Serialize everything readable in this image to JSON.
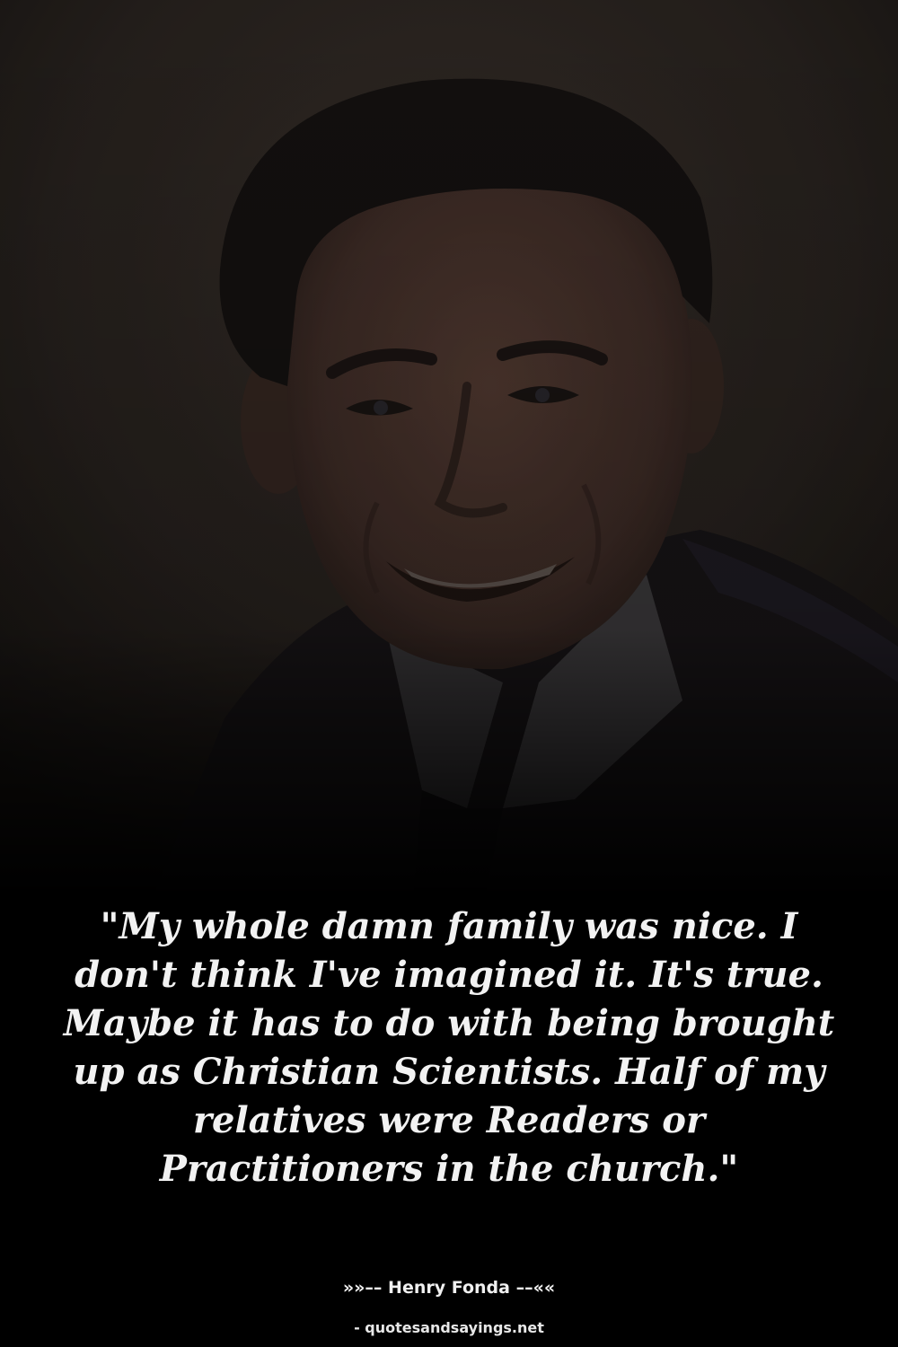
{
  "quote": {
    "text": "\"My whole damn family was nice. I don't think I've imagined it. It's true. Maybe it has to do with being brought up as Christian Scientists. Half of my relatives were Readers or Practitioners in the church.\""
  },
  "attribution": {
    "prefix": "»»–– ",
    "author": "Henry Fonda",
    "suffix": " ––««"
  },
  "credit": {
    "text": "- quotesandsayings.net"
  },
  "colors": {
    "background": "#000000",
    "text": "#f2f2f2",
    "backdrop": "#2a2420"
  }
}
